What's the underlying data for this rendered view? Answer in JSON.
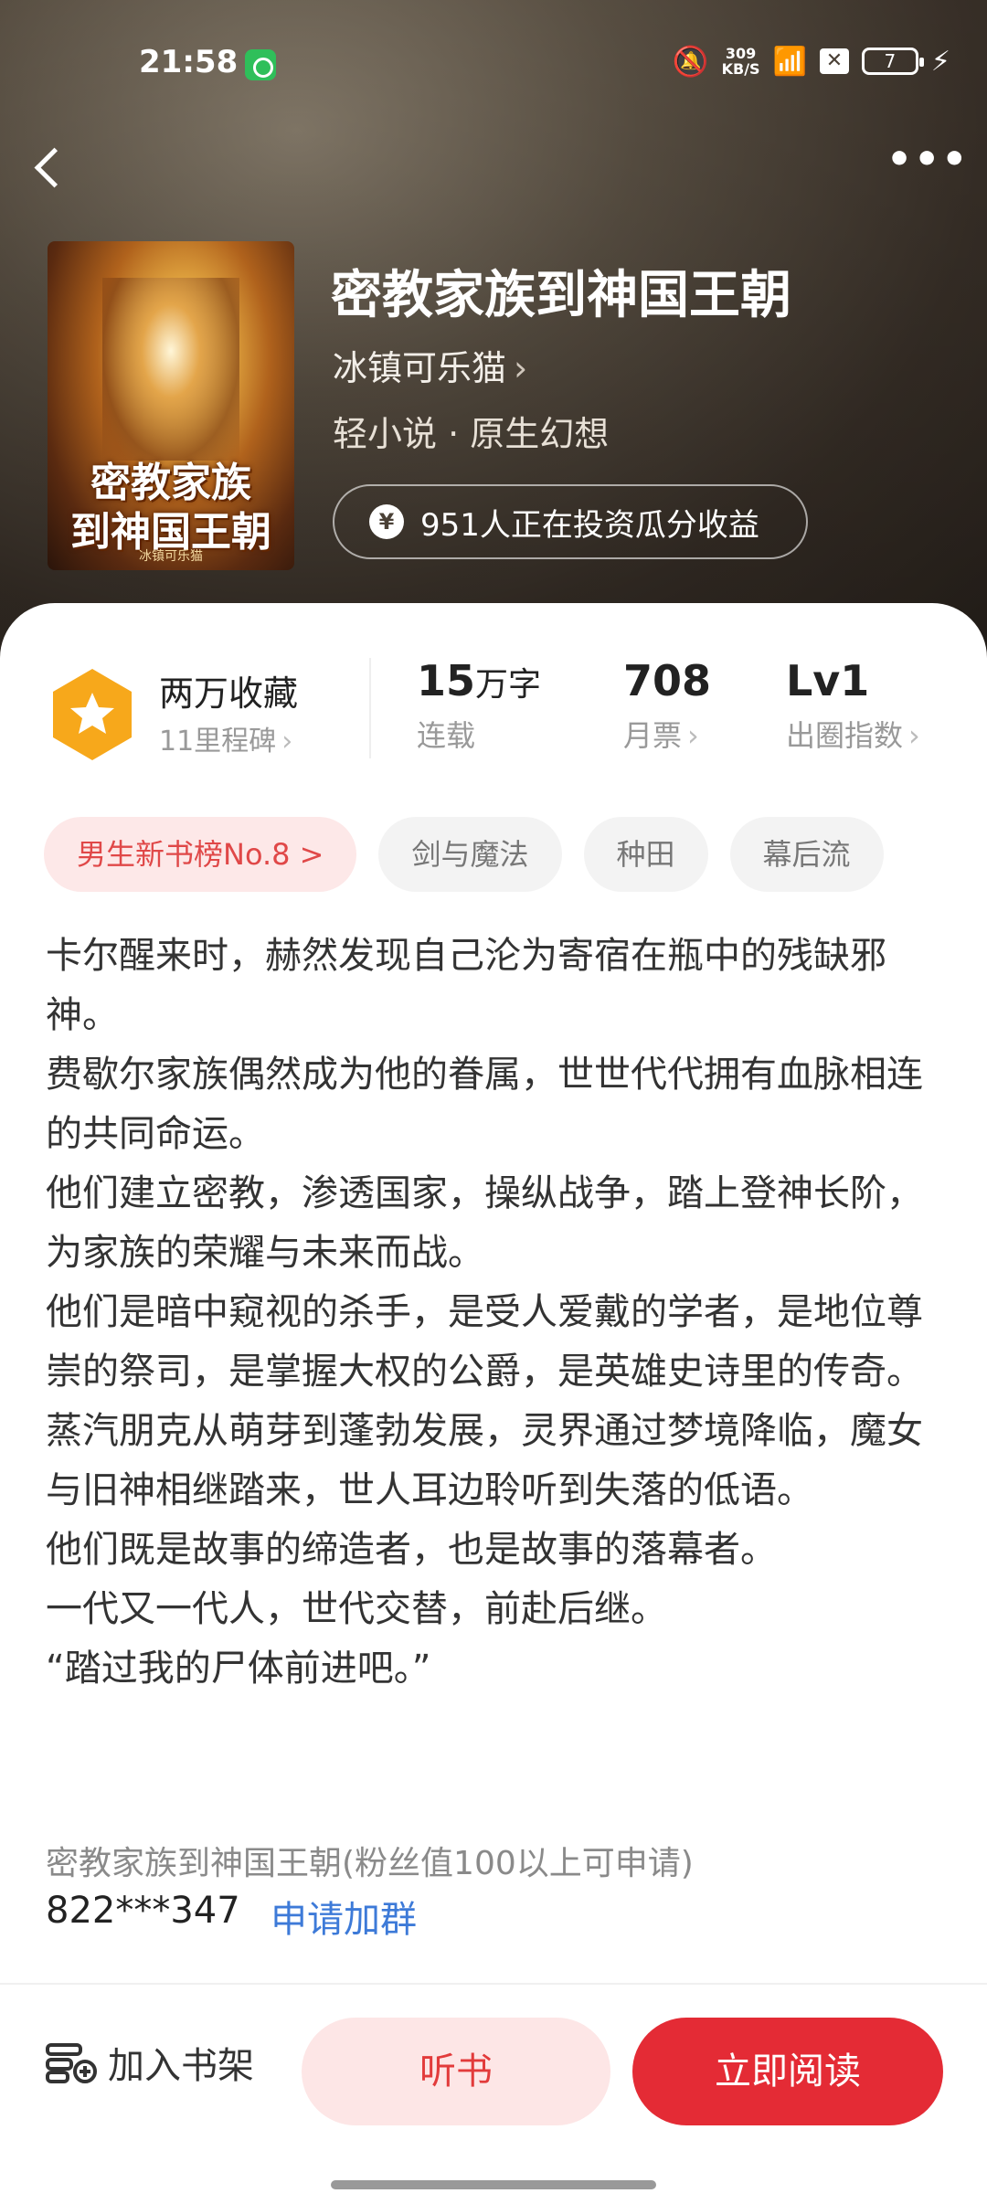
{
  "status_bar": {
    "time": "21:58",
    "speed_top": "309",
    "speed_unit": "KB/S",
    "battery": "7"
  },
  "book": {
    "title": "密教家族到神国王朝",
    "author": "冰镇可乐猫",
    "genre": "轻小说 · 原生幻想",
    "invest_text": "951人正在投资瓜分收益",
    "cover_title_line1": "密教家族",
    "cover_title_line2": "到神国王朝",
    "cover_author": "冰镇可乐猫"
  },
  "stats": {
    "favorites": "两万收藏",
    "milestone": "11里程碑",
    "word_count": "15",
    "word_unit": "万字",
    "word_status": "连载",
    "monthly_votes": "708",
    "monthly_votes_label": "月票",
    "level": "Lv1",
    "level_label": "出圈指数"
  },
  "tags": {
    "rank": "男生新书榜No.8 >",
    "items": [
      "剑与魔法",
      "种田",
      "幕后流"
    ]
  },
  "description": [
    "卡尔醒来时，赫然发现自己沦为寄宿在瓶中的残缺邪神。",
    "费歇尔家族偶然成为他的眷属，世世代代拥有血脉相连的共同命运。",
    "他们建立密教，渗透国家，操纵战争，踏上登神长阶，为家族的荣耀与未来而战。",
    "他们是暗中窥视的杀手，是受人爱戴的学者，是地位尊崇的祭司，是掌握大权的公爵，是英雄史诗里的传奇。",
    "蒸汽朋克从萌芽到蓬勃发展，灵界通过梦境降临，魔女与旧神相继踏来，世人耳边聆听到失落的低语。",
    "他们既是故事的缔造者，也是故事的落幕者。",
    "一代又一代人，世代交替，前赴后继。",
    "“踏过我的尸体前进吧。”"
  ],
  "group": {
    "name": "密教家族到神国王朝(粉丝值100以上可申请)",
    "id": "822***347",
    "join_label": "申请加群"
  },
  "actions": {
    "shelf": "加入书架",
    "listen": "听书",
    "read": "立即阅读"
  },
  "colors": {
    "accent_red": "#e42b35",
    "link_blue": "#3d7ad8",
    "badge_orange": "#f7a81b"
  }
}
